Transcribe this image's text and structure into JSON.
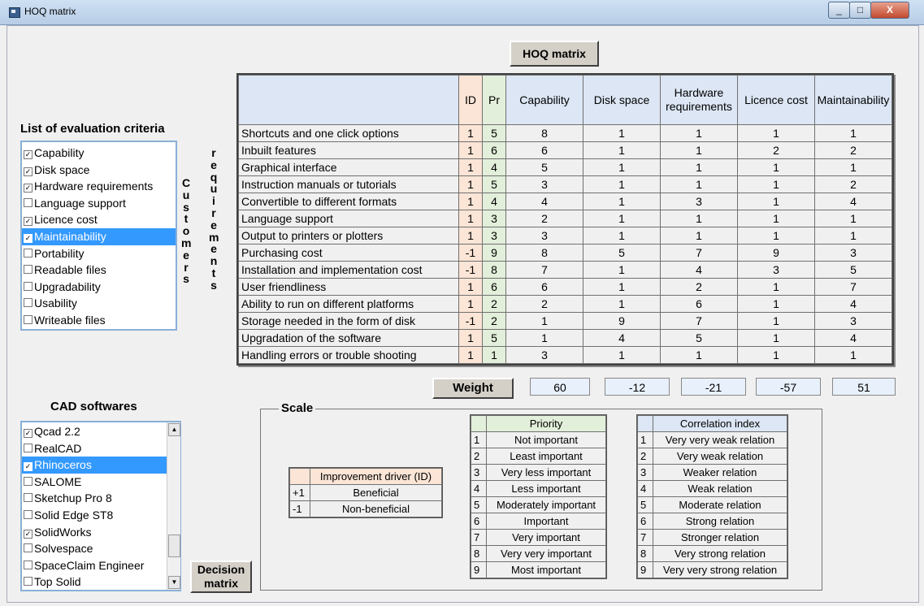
{
  "window": {
    "title": "HOQ matrix",
    "minimize": "_",
    "maximize": "□",
    "close": "X"
  },
  "hoq_button": "HOQ matrix",
  "criteria": {
    "heading": "List of evaluation criteria",
    "items": [
      {
        "label": "Capability",
        "checked": true,
        "selected": false
      },
      {
        "label": "Disk space",
        "checked": true,
        "selected": false
      },
      {
        "label": "Hardware requirements",
        "checked": true,
        "selected": false
      },
      {
        "label": "Language support",
        "checked": false,
        "selected": false
      },
      {
        "label": "Licence cost",
        "checked": true,
        "selected": false
      },
      {
        "label": "Maintainability",
        "checked": true,
        "selected": true
      },
      {
        "label": "Portability",
        "checked": false,
        "selected": false
      },
      {
        "label": "Readable files",
        "checked": false,
        "selected": false
      },
      {
        "label": "Upgradability",
        "checked": false,
        "selected": false
      },
      {
        "label": "Usability",
        "checked": false,
        "selected": false
      },
      {
        "label": "Writeable files",
        "checked": false,
        "selected": false
      }
    ]
  },
  "vertical_label_1": [
    "C",
    "u",
    "s",
    "t",
    "o",
    "m",
    "e",
    "r",
    "s"
  ],
  "vertical_label_2": [
    "r",
    "e",
    "q",
    "u",
    "i",
    "r",
    "e",
    "m",
    "e",
    "n",
    "t",
    "s"
  ],
  "table": {
    "headers": {
      "id": "ID",
      "pr": "Pr",
      "cols": [
        "Capability",
        "Disk space",
        "Hardware requirements",
        "Licence cost",
        "Maintainability"
      ]
    },
    "rows": [
      {
        "req": "Shortcuts and one click options",
        "id": "1",
        "pr": "5",
        "v": [
          "8",
          "1",
          "1",
          "1",
          "1"
        ]
      },
      {
        "req": "Inbuilt features",
        "id": "1",
        "pr": "6",
        "v": [
          "6",
          "1",
          "1",
          "2",
          "2"
        ]
      },
      {
        "req": "Graphical interface",
        "id": "1",
        "pr": "4",
        "v": [
          "5",
          "1",
          "1",
          "1",
          "1"
        ]
      },
      {
        "req": "Instruction manuals or tutorials",
        "id": "1",
        "pr": "5",
        "v": [
          "3",
          "1",
          "1",
          "1",
          "2"
        ]
      },
      {
        "req": "Convertible to different formats",
        "id": "1",
        "pr": "4",
        "v": [
          "4",
          "1",
          "3",
          "1",
          "4"
        ]
      },
      {
        "req": "Language support",
        "id": "1",
        "pr": "3",
        "v": [
          "2",
          "1",
          "1",
          "1",
          "1"
        ]
      },
      {
        "req": "Output to printers or plotters",
        "id": "1",
        "pr": "3",
        "v": [
          "3",
          "1",
          "1",
          "1",
          "1"
        ]
      },
      {
        "req": "Purchasing cost",
        "id": "-1",
        "pr": "9",
        "v": [
          "8",
          "5",
          "7",
          "9",
          "3"
        ]
      },
      {
        "req": "Installation and implementation cost",
        "id": "-1",
        "pr": "8",
        "v": [
          "7",
          "1",
          "4",
          "3",
          "5"
        ]
      },
      {
        "req": "User friendliness",
        "id": "1",
        "pr": "6",
        "v": [
          "6",
          "1",
          "2",
          "1",
          "7"
        ]
      },
      {
        "req": "Ability to run on different platforms",
        "id": "1",
        "pr": "2",
        "v": [
          "2",
          "1",
          "6",
          "1",
          "4"
        ]
      },
      {
        "req": "Storage needed in the form of disk",
        "id": "-1",
        "pr": "2",
        "v": [
          "1",
          "9",
          "7",
          "1",
          "3"
        ]
      },
      {
        "req": "Upgradation of the software",
        "id": "1",
        "pr": "5",
        "v": [
          "1",
          "4",
          "5",
          "1",
          "4"
        ]
      },
      {
        "req": "Handling errors or trouble shooting",
        "id": "1",
        "pr": "1",
        "v": [
          "3",
          "1",
          "1",
          "1",
          "1"
        ]
      }
    ]
  },
  "weight": {
    "label": "Weight",
    "values": [
      "60",
      "-12",
      "-21",
      "-57",
      "51"
    ]
  },
  "cad": {
    "heading": "CAD softwares",
    "items": [
      {
        "label": "Qcad 2.2",
        "checked": true,
        "selected": false
      },
      {
        "label": "RealCAD",
        "checked": false,
        "selected": false
      },
      {
        "label": "Rhinoceros",
        "checked": true,
        "selected": true
      },
      {
        "label": "SALOME",
        "checked": false,
        "selected": false
      },
      {
        "label": "Sketchup Pro 8",
        "checked": false,
        "selected": false
      },
      {
        "label": "Solid Edge ST8",
        "checked": false,
        "selected": false
      },
      {
        "label": "SolidWorks",
        "checked": true,
        "selected": false
      },
      {
        "label": "Solvespace",
        "checked": false,
        "selected": false
      },
      {
        "label": "SpaceClaim Engineer",
        "checked": false,
        "selected": false
      },
      {
        "label": "Top Solid",
        "checked": false,
        "selected": false
      }
    ]
  },
  "decision_button": {
    "line1": "Decision",
    "line2": "matrix"
  },
  "scale": {
    "title": "Scale",
    "improvement": {
      "header": "Improvement driver (ID)",
      "rows": [
        {
          "n": "+1",
          "t": "Beneficial"
        },
        {
          "n": "-1",
          "t": "Non-beneficial"
        }
      ]
    },
    "priority": {
      "header": "Priority",
      "rows": [
        {
          "n": "1",
          "t": "Not important"
        },
        {
          "n": "2",
          "t": "Least important"
        },
        {
          "n": "3",
          "t": "Very less important"
        },
        {
          "n": "4",
          "t": "Less important"
        },
        {
          "n": "5",
          "t": "Moderately important"
        },
        {
          "n": "6",
          "t": "Important"
        },
        {
          "n": "7",
          "t": "Very important"
        },
        {
          "n": "8",
          "t": "Very very important"
        },
        {
          "n": "9",
          "t": "Most important"
        }
      ]
    },
    "correlation": {
      "header": "Correlation index",
      "rows": [
        {
          "n": "1",
          "t": "Very very weak relation"
        },
        {
          "n": "2",
          "t": "Very weak relation"
        },
        {
          "n": "3",
          "t": "Weaker relation"
        },
        {
          "n": "4",
          "t": "Weak relation"
        },
        {
          "n": "5",
          "t": "Moderate relation"
        },
        {
          "n": "6",
          "t": "Strong relation"
        },
        {
          "n": "7",
          "t": "Stronger relation"
        },
        {
          "n": "8",
          "t": "Very strong relation"
        },
        {
          "n": "9",
          "t": "Very very strong relation"
        }
      ]
    }
  }
}
